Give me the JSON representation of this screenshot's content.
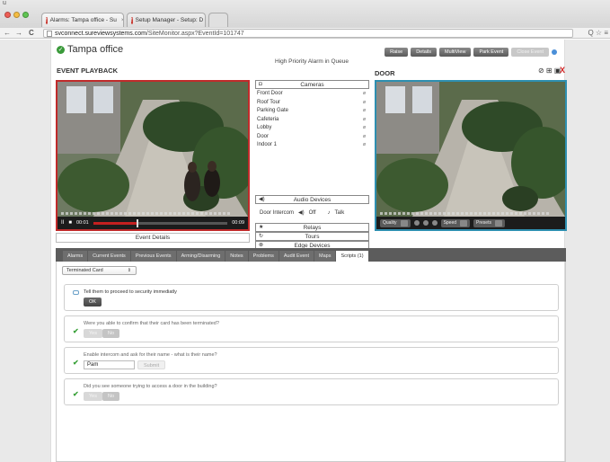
{
  "browser": {
    "corner_glyph": "u",
    "tabs": [
      {
        "label": "Alarms: Tampa office - Su",
        "close": "×"
      },
      {
        "label": "Setup Manager - Setup: D",
        "close": "×"
      }
    ],
    "nav": {
      "back": "←",
      "forward": "→",
      "reload": "C"
    },
    "url_host": "svconnect.sureviewsystems.com",
    "url_path": "/SiteMonitor.aspx?EventId=101747",
    "toolbar_icons": "Q ☆ ≡"
  },
  "header": {
    "site_name": "Tampa office",
    "queue_text": "High Priority Alarm in Queue",
    "actions": [
      "Raise",
      "Details",
      "MultiView",
      "Park Event",
      "Close Event"
    ]
  },
  "playback": {
    "title": "EVENT PLAYBACK",
    "play_glyph": "II",
    "stop_glyph": "■",
    "time_current": "00:01",
    "time_total": "00:09",
    "progress_fraction": 0.32,
    "event_details_label": "Event Details"
  },
  "door": {
    "title": "DOOR",
    "icons": "⊘ ⊞ ▣",
    "close_glyph": "X",
    "quality_label": "Quality",
    "speed_label": "Speed",
    "presets_label": "Presets"
  },
  "cameras": {
    "heading": "Cameras",
    "items": [
      "Front Door",
      "Roof Tour",
      "Parking Gate",
      "Cafeteria",
      "Lobby",
      "Door",
      "Indoor 1"
    ],
    "item_icon": "ø"
  },
  "audio": {
    "heading": "Audio Devices",
    "device": "Door Intercom",
    "off_label": "Off",
    "talk_label": "Talk"
  },
  "relays_label": "Relays",
  "tours_label": "Tours",
  "edge_label": "Edge Devices",
  "tabs": [
    "Alarms",
    "Current Events",
    "Previous Events",
    "Arming/Disarming",
    "Notes",
    "Problems",
    "Audit Event",
    "Maps",
    "Scripts (1)"
  ],
  "active_tab_index": 8,
  "scripts": {
    "selected": "Terminated Card",
    "select_arrow": "⇕",
    "steps": [
      {
        "question": "Tell them to proceed to security immediatly",
        "buttons": [
          "OK"
        ]
      },
      {
        "question": "Were you able to confirm that their card has been terminated?",
        "buttons": [
          "Yes",
          "No"
        ]
      },
      {
        "question": "Enable intercom and ask for their name - what is their name?",
        "input_value": "Pam",
        "buttons": [
          "Submit"
        ]
      },
      {
        "question": "Did you see someone trying to access a door in the building?",
        "buttons": [
          "Yes",
          "No"
        ]
      }
    ]
  },
  "colors": {
    "accent_red": "#c02b2b",
    "accent_blue": "#2e8fb0",
    "check_green": "#3aa13a"
  }
}
